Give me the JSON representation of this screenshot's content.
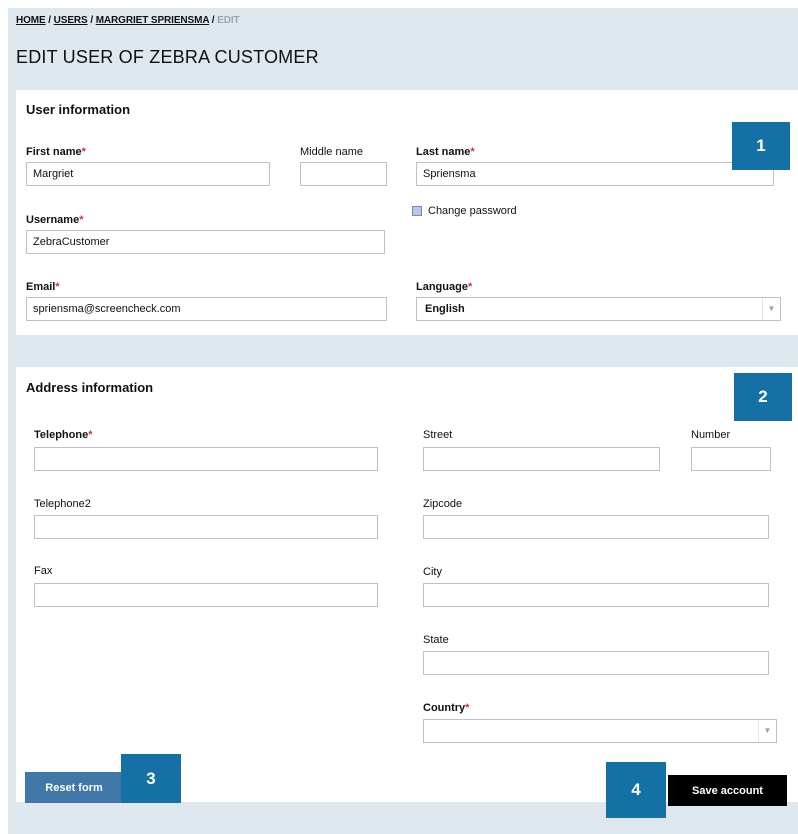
{
  "breadcrumb": {
    "home": "HOME",
    "users": "USERS",
    "user": "MARGRIET SPRIENSMA",
    "current": "EDIT",
    "separator": "/"
  },
  "page_title": "EDIT USER OF ZEBRA CUSTOMER",
  "user_section": {
    "title": "User information",
    "first_name_label": "First name",
    "first_name_value": "Margriet",
    "middle_name_label": "Middle name",
    "middle_name_value": "",
    "last_name_label": "Last name",
    "last_name_value": "Spriensma",
    "username_label": "Username",
    "username_value": "ZebraCustomer",
    "change_password_label": "Change password",
    "email_label": "Email",
    "email_value": "spriensma@screencheck.com",
    "language_label": "Language",
    "language_value": "English",
    "required_marker": "*"
  },
  "address_section": {
    "title": "Address information",
    "telephone_label": "Telephone",
    "telephone_value": "",
    "telephone2_label": "Telephone2",
    "telephone2_value": "",
    "fax_label": "Fax",
    "fax_value": "",
    "street_label": "Street",
    "street_value": "",
    "number_label": "Number",
    "number_value": "",
    "zipcode_label": "Zipcode",
    "zipcode_value": "",
    "city_label": "City",
    "city_value": "",
    "state_label": "State",
    "state_value": "",
    "country_label": "Country",
    "country_value": ""
  },
  "callouts": [
    "1",
    "2",
    "3",
    "4"
  ],
  "buttons": {
    "reset": "Reset form",
    "save": "Save account"
  },
  "colors": {
    "accent": "#1570a6",
    "reset_button": "#3f78a8",
    "save_button": "#000000",
    "required": "#c8373c",
    "background": "#dfe7ef"
  },
  "icons": {
    "dropdown": "chevron-down-icon",
    "checkbox": "checkbox-icon"
  }
}
